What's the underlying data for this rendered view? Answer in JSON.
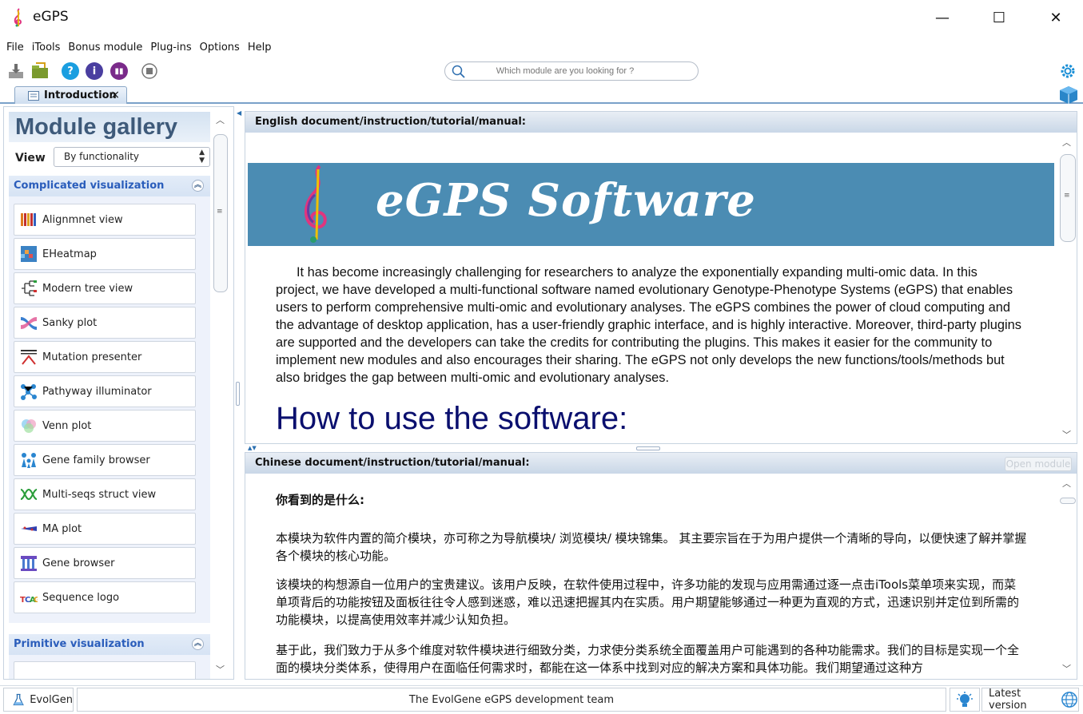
{
  "window": {
    "title": "eGPS",
    "minimize": "—",
    "maximize": "☐",
    "close": "✕"
  },
  "menu": [
    "File",
    "iTools",
    "Bonus module",
    "Plug-ins",
    "Options",
    "Help"
  ],
  "search": {
    "placeholder": "Which module are you looking for ?"
  },
  "tab": {
    "label": "Introduction",
    "close": "×"
  },
  "gallery": {
    "title": "Module gallery",
    "view_label": "View",
    "view_value": "By functionality",
    "sections": [
      {
        "title": "Complicated visualization",
        "items": [
          {
            "label": "Alignmnet view",
            "icon": "alignment-icon"
          },
          {
            "label": "EHeatmap",
            "icon": "heatmap-icon"
          },
          {
            "label": "Modern tree view",
            "icon": "tree-icon"
          },
          {
            "label": "Sanky plot",
            "icon": "sankey-icon"
          },
          {
            "label": "Mutation presenter",
            "icon": "mutation-icon"
          },
          {
            "label": "Pathyway illuminator",
            "icon": "pathway-icon"
          },
          {
            "label": "Venn plot",
            "icon": "venn-icon"
          },
          {
            "label": "Gene family browser",
            "icon": "gene-family-icon"
          },
          {
            "label": "Multi-seqs struct view",
            "icon": "multi-seq-icon"
          },
          {
            "label": "MA plot",
            "icon": "ma-plot-icon"
          },
          {
            "label": "Gene browser",
            "icon": "gene-browser-icon"
          },
          {
            "label": "Sequence logo",
            "icon": "sequence-logo-icon"
          }
        ]
      },
      {
        "title": "Primitive visualization",
        "items": []
      }
    ]
  },
  "english_pane": {
    "header": "English document/instruction/tutorial/manual:",
    "banner_text": "eGPS Software",
    "paragraph": "It has become increasingly challenging for researchers to analyze the exponentially expanding multi-omic data. In this project, we have developed a multi-functional software named evolutionary Genotype-Phenotype Systems (eGPS) that enables users to perform comprehensive multi-omic and evolutionary analyses. The eGPS combines the power of cloud computing and the advantage of desktop application, has a user-friendly graphic interface, and is highly interactive. Moreover, third-party plugins are supported and the developers can take the credits for contributing the plugins. This makes it easier for the community to implement new modules and also encourages their sharing. The eGPS not only develops the new functions/tools/methods but also bridges the gap between multi-omic and evolutionary analyses.",
    "heading": "How to use the software:"
  },
  "chinese_pane": {
    "header": "Chinese document/instruction/tutorial/manual:",
    "open_module": "Open module",
    "heading": "你看到的是什么:",
    "p1": "本模块为软件内置的简介模块，亦可称之为导航模块/ 浏览模块/ 模块锦集。 其主要宗旨在于为用户提供一个清晰的导向，以便快速了解并掌握各个模块的核心功能。",
    "p2": "该模块的构想源自一位用户的宝贵建议。该用户反映，在软件使用过程中，许多功能的发现与应用需通过逐一点击iTools菜单项来实现，而菜单项背后的功能按钮及面板往往令人感到迷惑，难以迅速把握其内在实质。用户期望能够通过一种更为直观的方式，迅速识别并定位到所需的功能模块，以提高使用效率并减少认知负担。",
    "p3": "基于此，我们致力于从多个维度对软件模块进行细致分类，力求使分类系统全面覆盖用户可能遇到的各种功能需求。我们的目标是实现一个全面的模块分类体系，使得用户在面临任何需求时，都能在这一体系中找到对应的解决方案和具体功能。我们期望通过这种方"
  },
  "status": {
    "left": "EvolGen",
    "center": "The EvolGene eGPS development team",
    "right": "Latest version"
  }
}
